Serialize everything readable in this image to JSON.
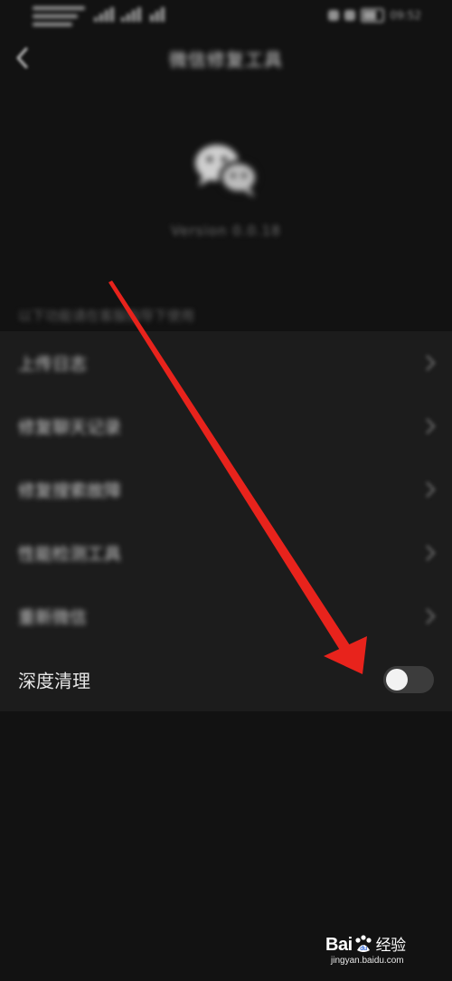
{
  "status_bar": {
    "time": "09:52"
  },
  "header": {
    "title": "微信修复工具"
  },
  "app_info": {
    "version": "Version 0.0.18"
  },
  "list": {
    "section_hint": "以下功能请在客服指导下使用",
    "items": [
      {
        "label": "上传日志"
      },
      {
        "label": "修复聊天记录"
      },
      {
        "label": "修复搜索故障"
      },
      {
        "label": "性能检测工具"
      },
      {
        "label": "重新微信"
      }
    ],
    "deep_clean": {
      "label": "深度清理",
      "enabled": false
    }
  },
  "annotation": {
    "arrow_color": "#e8231c"
  },
  "watermark": {
    "brand_prefix": "Bai",
    "brand_suffix": "经验",
    "site": "jingyan.baidu.com"
  },
  "colors": {
    "background": "#121212",
    "panel": "#1c1c1c",
    "toggle_off_track": "#3c3c3c",
    "toggle_knob": "#f2f2f2"
  }
}
